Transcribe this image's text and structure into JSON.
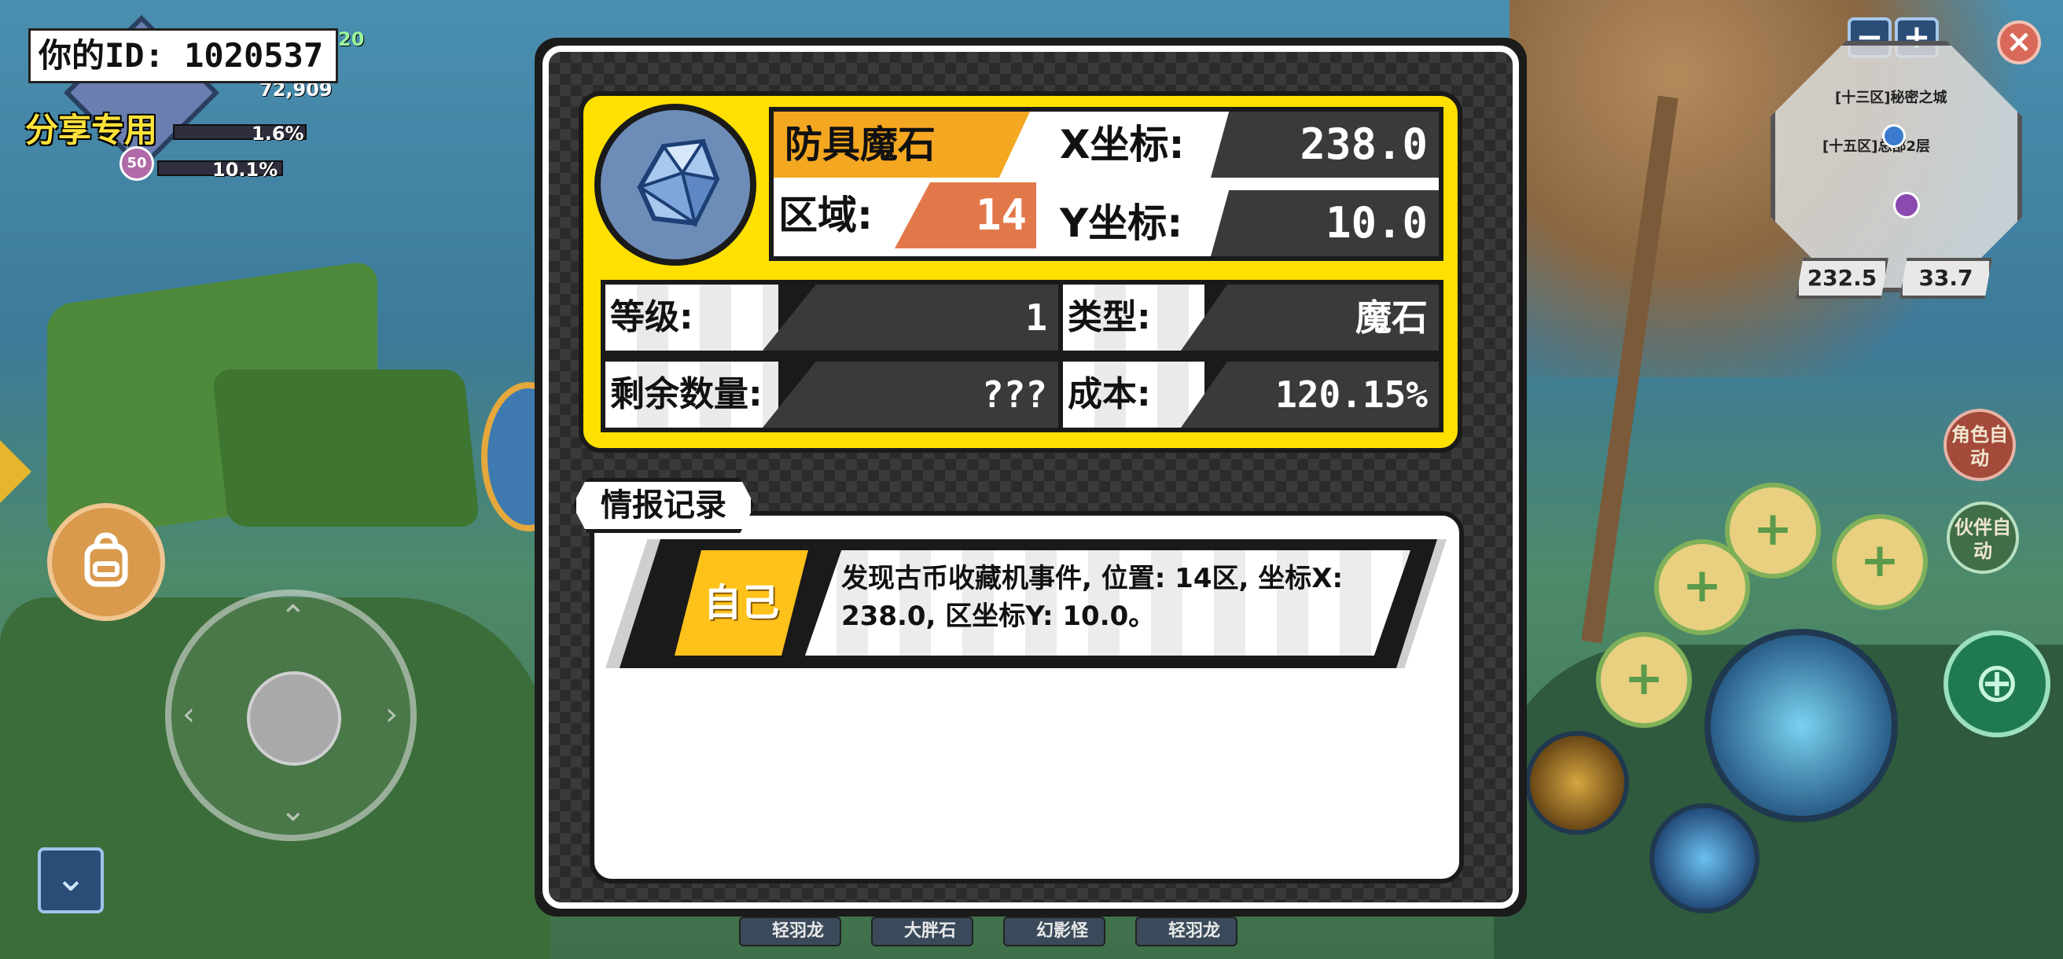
{
  "player": {
    "id_label": "你的ID: 1020537",
    "share_label": "分享专用",
    "stat_top": "72,909",
    "stat_mid": "1.6%",
    "stat_low": "10.1%",
    "level": "50",
    "level_corner": "20"
  },
  "minimap": {
    "area_1": "[十三区]秘密之城",
    "area_2": "[十五区]总部2层",
    "coord_x": "232.5",
    "coord_y": "33.7",
    "zoom_out": "−",
    "zoom_in": "+",
    "close": "×"
  },
  "right_hud": {
    "auto_role": "角色自动",
    "auto_partner": "伙伴自动"
  },
  "bottom_tags": [
    "轻羽龙",
    "大胖石",
    "幻影怪",
    "轻羽龙"
  ],
  "item": {
    "name": "防具魔石",
    "region_label": "区域:",
    "region_value": "14",
    "x_label": "X坐标:",
    "x_value": "238.0",
    "y_label": "Y坐标:",
    "y_value": "10.0",
    "level_label": "等级:",
    "level_value": "1",
    "type_label": "类型:",
    "type_value": "魔石",
    "remaining_label": "剩余数量:",
    "remaining_value": "???",
    "cost_label": "成本:",
    "cost_value": "120.15%"
  },
  "intel": {
    "tab_label": "情报记录",
    "entries": [
      {
        "source": "自己",
        "text": "发现古币收藏机事件, 位置: 14区, 坐标X: 238.0, 区坐标Y: 10.0。"
      }
    ]
  },
  "colors": {
    "accent_yellow": "#ffe000",
    "name_orange": "#f4a720",
    "region_orange": "#e2784a",
    "panel_dark": "#3a3a3a",
    "source_yellow": "#ffc21a"
  },
  "icons": {
    "item_icon": "magic-stone-icon",
    "backpack": "backpack-icon",
    "collapse": "chevron-down-icon",
    "aim": "crosshair-icon",
    "heal": "heart-plus-icon"
  }
}
